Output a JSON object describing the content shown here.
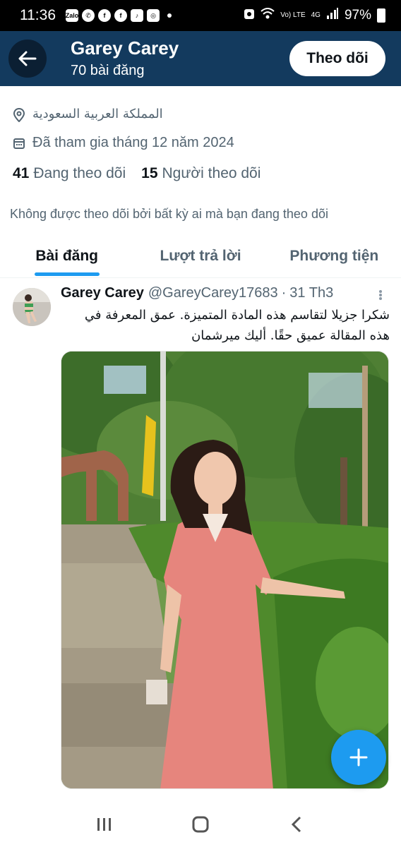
{
  "status_bar": {
    "time": "11:36",
    "app_icons": [
      "Zalo",
      "whatsapp-icon",
      "facebook-icon",
      "facebook-icon",
      "tiktok-icon",
      "instagram-icon"
    ],
    "network_label": "Vo) LTE",
    "network_type": "4G",
    "battery": "97%"
  },
  "header": {
    "name": "Garey Carey",
    "posts_count": "70 bài đăng",
    "follow_label": "Theo dõi"
  },
  "profile": {
    "location": "المملكة العربية السعودية",
    "joined": "Đã tham gia tháng 12 năm 2024",
    "following_count": "41",
    "following_label": "Đang theo dõi",
    "followers_count": "15",
    "followers_label": "Người theo dõi",
    "not_followed_note": "Không được theo dõi bởi bất kỳ ai mà bạn đang theo dõi"
  },
  "tabs": [
    {
      "label": "Bài đăng",
      "active": true
    },
    {
      "label": "Lượt trả lời",
      "active": false
    },
    {
      "label": "Phương tiện",
      "active": false
    }
  ],
  "post": {
    "author_name": "Garey Carey",
    "handle": "@GareyCarey17683",
    "separator": "·",
    "date": "31 Th3",
    "text_line1": "شكرا جزيلا لتقاسم هذه المادة المتميزة. عمق المعرفة في",
    "text_line2": "هذه المقالة عميق حقًا. أليك ميرشمان"
  },
  "colors": {
    "header_bg": "#133a5e",
    "accent": "#1d9bf0",
    "text_primary": "#0f1419",
    "text_secondary": "#536471"
  }
}
